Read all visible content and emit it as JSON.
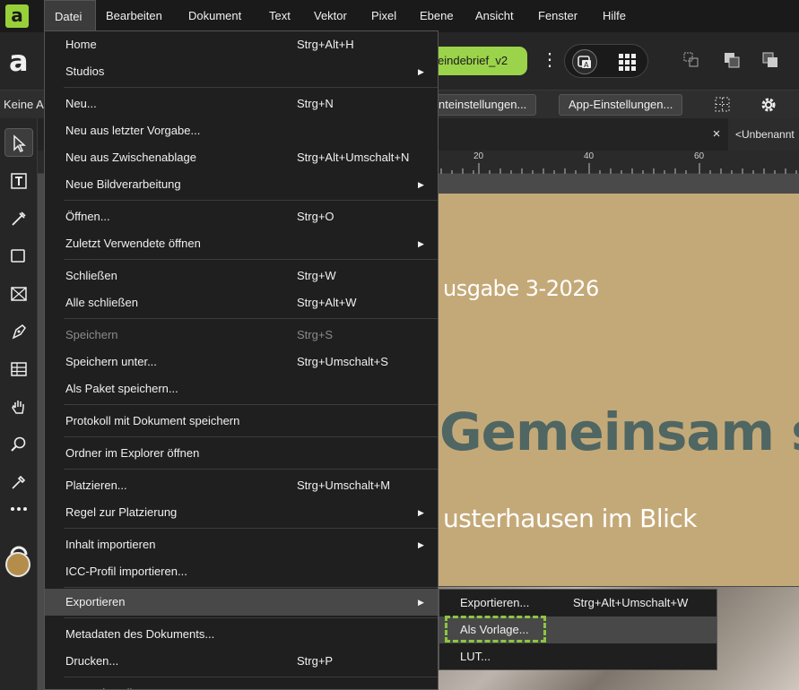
{
  "menubar": {
    "items": [
      "Datei",
      "Bearbeiten",
      "Dokument",
      "Text",
      "Vektor",
      "Pixel",
      "Ebene",
      "Ansicht",
      "Fenster",
      "Hilfe"
    ],
    "active_index": 0
  },
  "toolbar": {
    "app_logo": "a",
    "document_pill": "eindebrief_v2",
    "more_icon": "⋮"
  },
  "contextbar": {
    "left_text": "Keine A",
    "document_settings_button": "nteinstellungen...",
    "app_settings_button": "App-Einstellungen..."
  },
  "tabs": {
    "close_symbol": "×",
    "next_tab": "<Unbenannt"
  },
  "ruler": {
    "numbers": [
      "20",
      "40",
      "60"
    ]
  },
  "canvas": {
    "issue_text": "usgabe 3-2026",
    "headline": "Gemeinsam s",
    "subline": "usterhausen im Blick"
  },
  "file_menu": {
    "items": [
      {
        "label": "Home",
        "shortcut": "Strg+Alt+H"
      },
      {
        "label": "Studios",
        "submenu": true
      },
      {
        "label": "Neu...",
        "shortcut": "Strg+N"
      },
      {
        "label": "Neu aus letzter Vorgabe..."
      },
      {
        "label": "Neu aus Zwischenablage",
        "shortcut": "Strg+Alt+Umschalt+N"
      },
      {
        "label": "Neue Bildverarbeitung",
        "submenu": true
      },
      {
        "label": "Öffnen...",
        "shortcut": "Strg+O"
      },
      {
        "label": "Zuletzt Verwendete öffnen",
        "submenu": true
      },
      {
        "label": "Schließen",
        "shortcut": "Strg+W"
      },
      {
        "label": "Alle schließen",
        "shortcut": "Strg+Alt+W"
      },
      {
        "label": "Speichern",
        "shortcut": "Strg+S",
        "disabled": true
      },
      {
        "label": "Speichern unter...",
        "shortcut": "Strg+Umschalt+S"
      },
      {
        "label": "Als Paket speichern..."
      },
      {
        "label": "Protokoll mit Dokument speichern"
      },
      {
        "label": "Ordner im Explorer öffnen"
      },
      {
        "label": "Platzieren...",
        "shortcut": "Strg+Umschalt+M"
      },
      {
        "label": "Regel zur Platzierung",
        "submenu": true
      },
      {
        "label": "Inhalt importieren",
        "submenu": true
      },
      {
        "label": "ICC-Profil importieren..."
      },
      {
        "label": "Exportieren",
        "submenu": true,
        "highlighted": true
      },
      {
        "label": "Metadaten des Dokuments..."
      },
      {
        "label": "Drucken...",
        "shortcut": "Strg+P"
      },
      {
        "label": "Kontoeinstell..."
      }
    ],
    "submenu_arrow": "▶"
  },
  "export_submenu": {
    "items": [
      {
        "label": "Exportieren...",
        "shortcut": "Strg+Alt+Umschalt+W"
      },
      {
        "label": "Als Vorlage...",
        "highlighted": true
      },
      {
        "label": "LUT..."
      }
    ]
  },
  "colors": {
    "accent_green": "#9bd34a",
    "focus_dash": "#8dc63f",
    "page_tan": "#c4a978",
    "headline_teal": "#4f6663"
  }
}
